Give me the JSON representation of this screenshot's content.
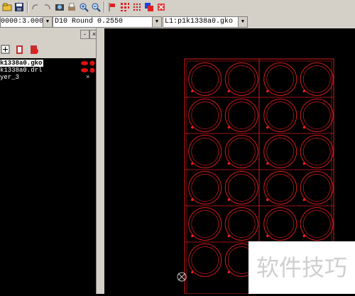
{
  "toolbar": {
    "icons": [
      "open-icon",
      "save-icon",
      "undo-icon",
      "redo-icon",
      "camera-icon",
      "print-icon",
      "zoom-in-icon",
      "zoom-out-icon",
      "flag-icon",
      "grid-icon",
      "dots-icon",
      "layers-color-icon",
      "delete-icon"
    ]
  },
  "fields": {
    "coord": "0000:3.0000",
    "aperture": "D10    Round 0.2550",
    "layer": "L1:p1k1338a0.gko"
  },
  "panel": {
    "layers": [
      {
        "name": "k1338a0.gko",
        "selected": true,
        "marker": "dots"
      },
      {
        "name": "k1338a0.drl",
        "selected": false,
        "marker": "dots"
      },
      {
        "name": "yer_3",
        "selected": false,
        "marker": "x"
      }
    ]
  },
  "board": {
    "rows": 6,
    "cols": 4,
    "trace_color": "#d01c1c"
  },
  "watermark": "软件技巧"
}
